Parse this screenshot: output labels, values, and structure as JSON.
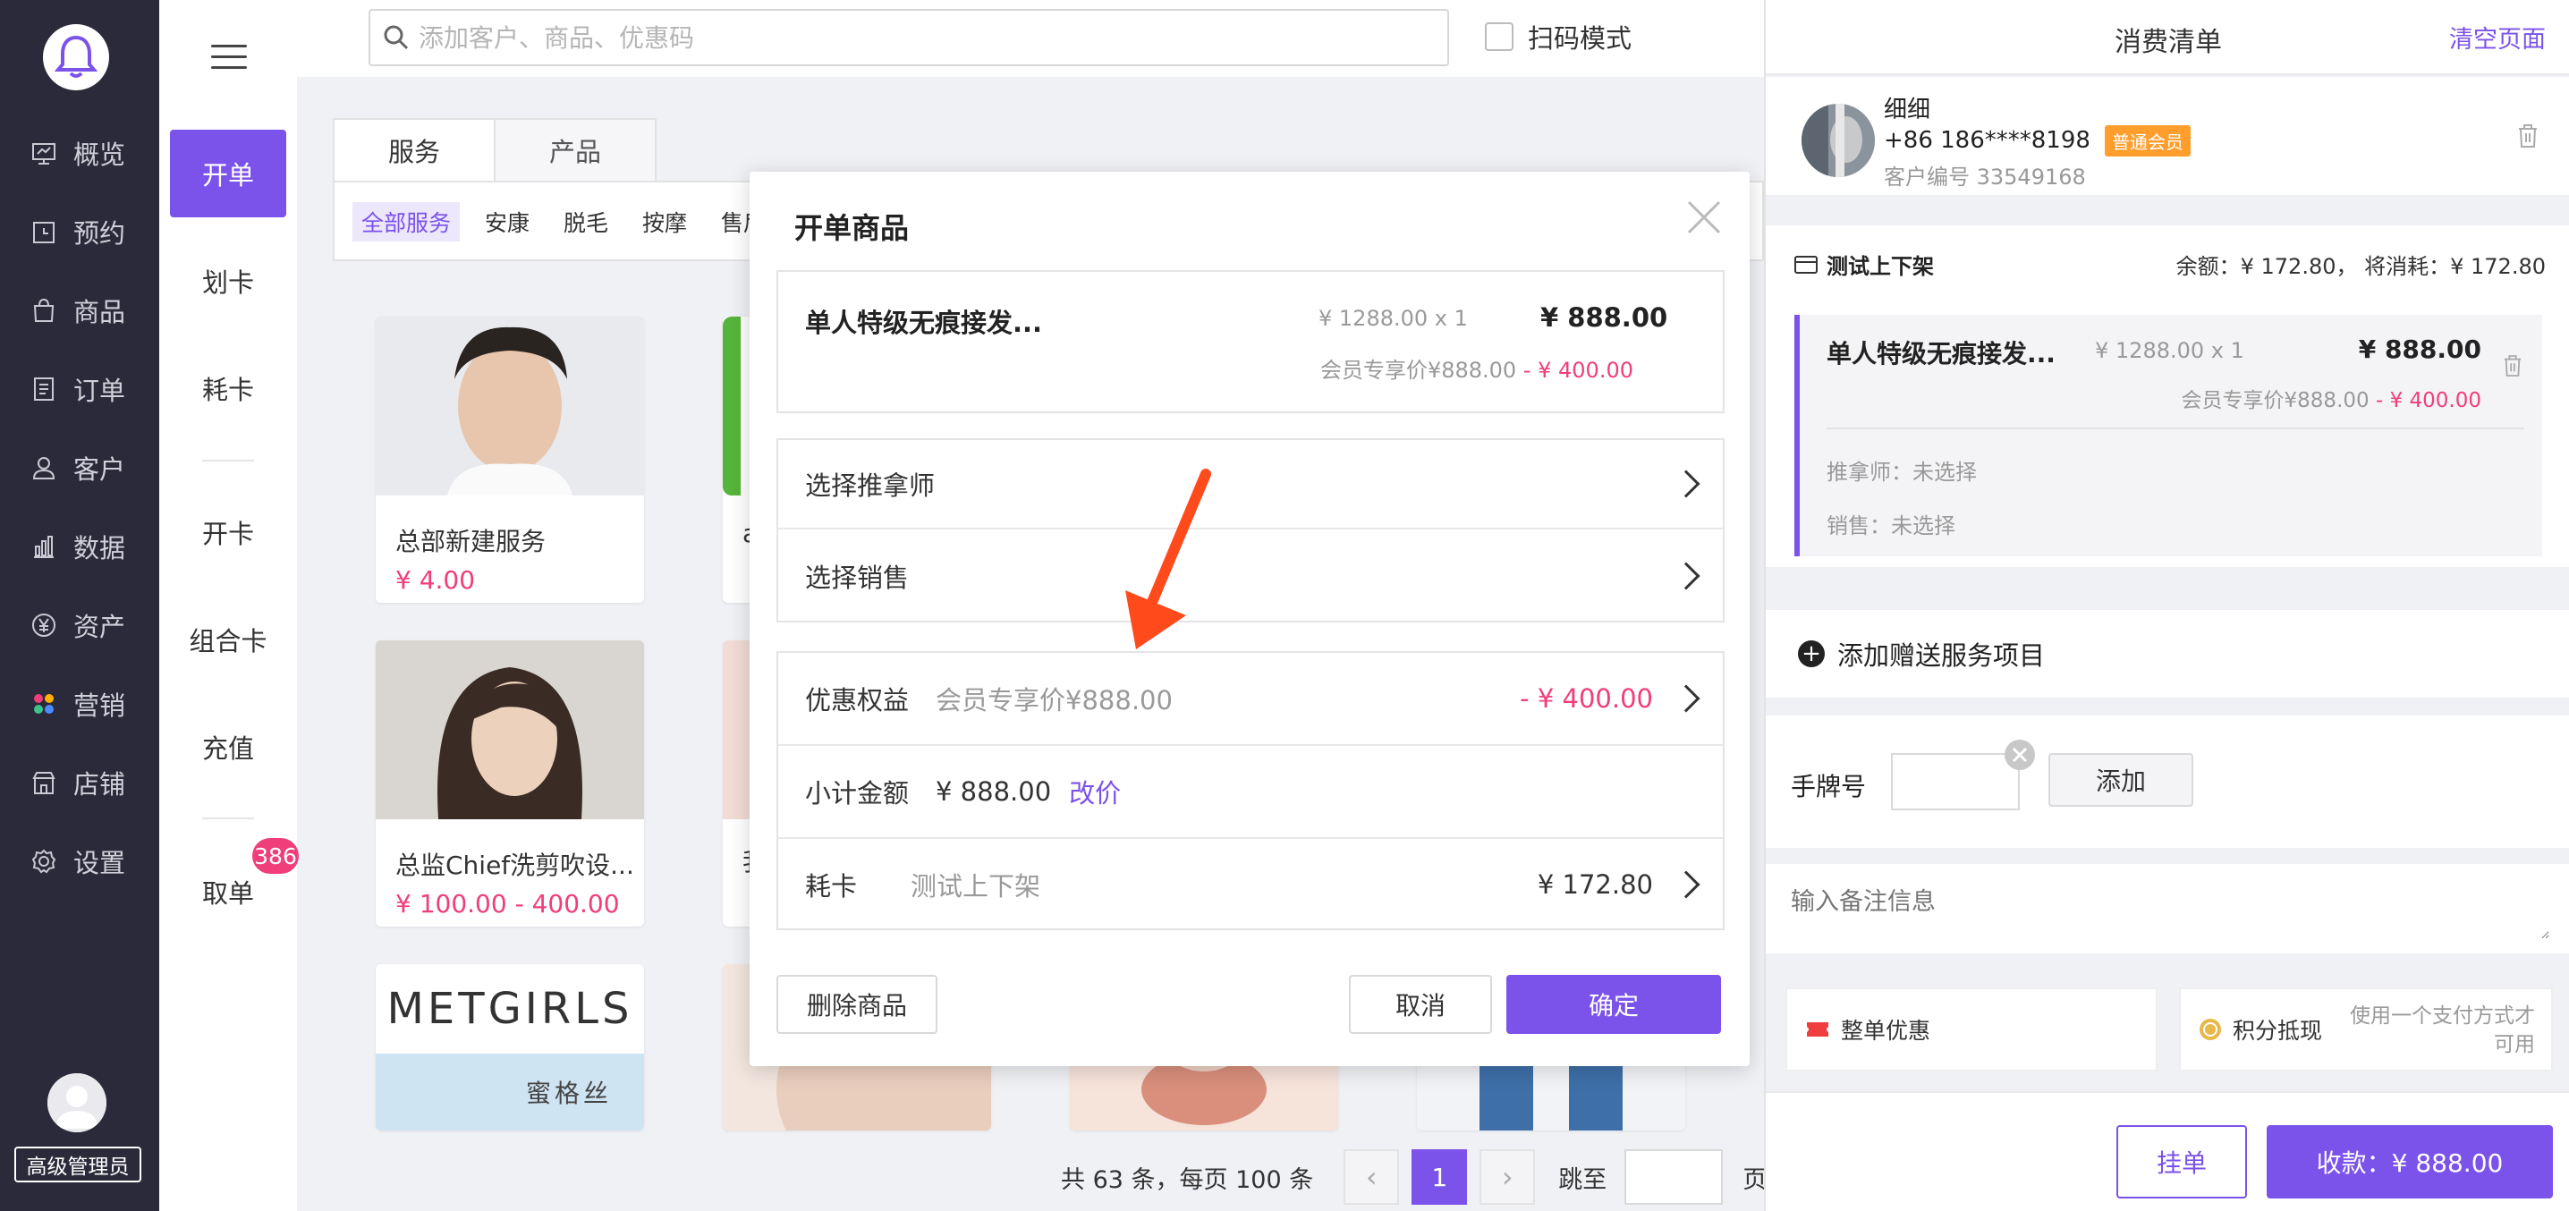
{
  "sidebar": {
    "items": [
      {
        "label": "概览",
        "icon": "overview-icon"
      },
      {
        "label": "预约",
        "icon": "calendar-icon"
      },
      {
        "label": "商品",
        "icon": "bag-icon"
      },
      {
        "label": "订单",
        "icon": "order-icon"
      },
      {
        "label": "客户",
        "icon": "user-icon"
      },
      {
        "label": "数据",
        "icon": "chart-icon"
      },
      {
        "label": "资产",
        "icon": "yen-icon"
      },
      {
        "label": "营销",
        "icon": "marketing-icon"
      },
      {
        "label": "店铺",
        "icon": "store-icon"
      },
      {
        "label": "设置",
        "icon": "gear-icon"
      }
    ],
    "role": "高级管理员"
  },
  "subnav": {
    "items": [
      "开单",
      "划卡",
      "耗卡",
      "开卡",
      "组合卡",
      "充值",
      "取单"
    ],
    "badge": "386"
  },
  "search": {
    "placeholder": "添加客户、商品、优惠码"
  },
  "scan_mode_label": "扫码模式",
  "tabs": [
    "服务",
    "产品"
  ],
  "filters": [
    "全部服务",
    "安康",
    "脱毛",
    "按摩",
    "售后"
  ],
  "cards": [
    {
      "title": "总部新建服务",
      "price": "¥ 4.00"
    },
    {
      "title": "总监Chief洗剪吹设...",
      "price": "¥ 100.00 - 400.00"
    },
    {
      "title": "a",
      "price": ""
    },
    {
      "title": "我",
      "price": ""
    }
  ],
  "metgirls": {
    "logo": "METGIRLS",
    "sub": "蜜格丝"
  },
  "pagination": {
    "summary": "共 63 条，每页 100 条",
    "current": "1",
    "jump_label": "跳至",
    "page_label": "页"
  },
  "modal": {
    "title": "开单商品",
    "item": {
      "name": "单人特级无痕接发...",
      "unit": "¥ 1288.00 x 1",
      "total": "¥ 888.00",
      "member_note": "会员专享价¥888.00",
      "discount": " - ¥ 400.00"
    },
    "select_masseur": "选择推拿师",
    "select_sales": "选择销售",
    "benefit_label": "优惠权益",
    "benefit_desc": "会员专享价¥888.00",
    "benefit_value": "- ¥ 400.00",
    "subtotal_label": "小计金额",
    "subtotal_value": "¥ 888.00",
    "change_price": "改价",
    "card_label": "耗卡",
    "card_name": "测试上下架",
    "card_value": "¥ 172.80",
    "delete": "删除商品",
    "cancel": "取消",
    "confirm": "确定"
  },
  "right": {
    "title": "消费清单",
    "clear": "清空页面",
    "customer": {
      "name": "细细",
      "phone": "+86 186****8198",
      "member_tag": "普通会员",
      "id": "客户编号 33549168"
    },
    "card_name": "测试上下架",
    "balance": "余额：¥ 172.80， 将消耗：¥ 172.80",
    "item": {
      "name": "单人特级无痕接发...",
      "unit": "¥ 1288.00 x 1",
      "total": "¥ 888.00",
      "member_note": "会员专享价¥888.00",
      "discount": " - ¥ 400.00",
      "masseur": "推拿师：未选择",
      "sales": "销售：未选择"
    },
    "add_gift": "添加赠送服务项目",
    "tag_label": "手牌号",
    "tag_add": "添加",
    "remark_placeholder": "输入备注信息",
    "whole_discount": "整单优惠",
    "points": "积分抵现",
    "payment_note_1": "使用一个支付方式才",
    "payment_note_2": "可用",
    "hold": "挂单",
    "checkout": "收款：¥ 888.00"
  },
  "colors": {
    "accent": "#7b52ea",
    "price": "#f03e7a",
    "sidebar": "#2b2a3a",
    "arrow": "#ff4a1c"
  }
}
